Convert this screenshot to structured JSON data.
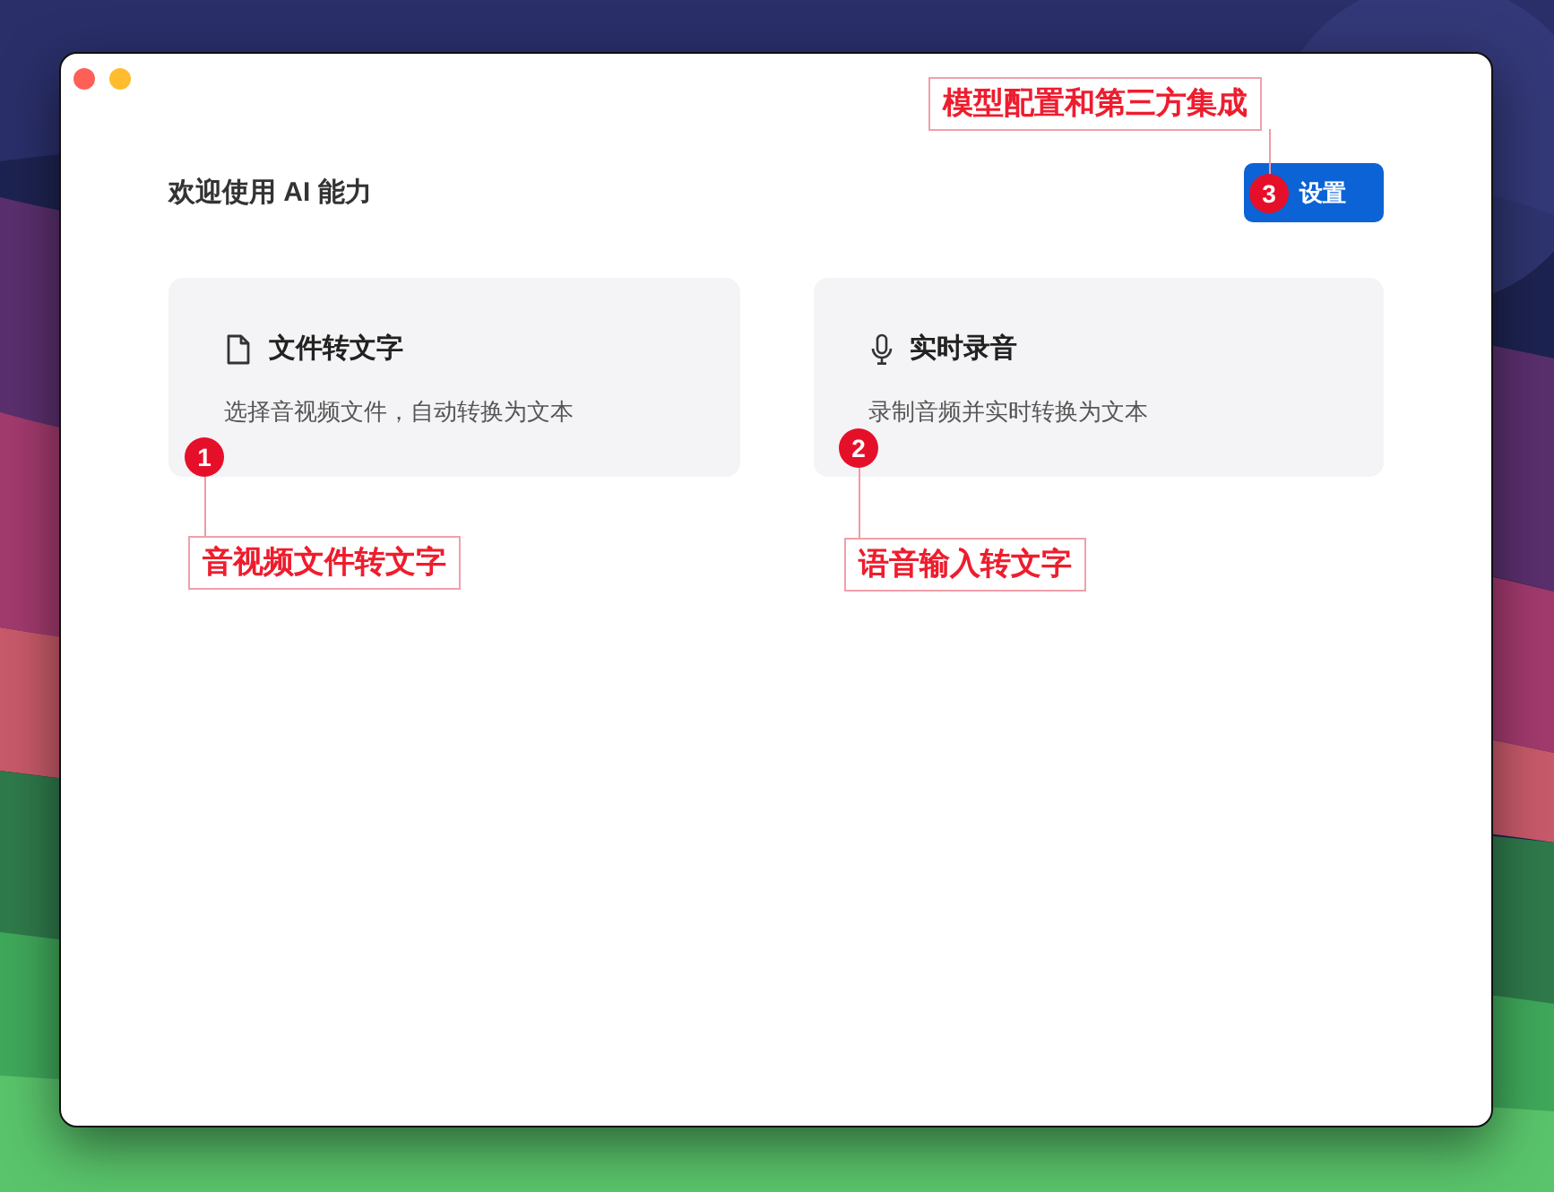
{
  "header": {
    "title": "欢迎使用 AI 能力",
    "settings_button": "设置"
  },
  "cards": [
    {
      "kind": "file",
      "title": "文件转文字",
      "description": "选择音视频文件，自动转换为文本"
    },
    {
      "kind": "microphone",
      "title": "实时录音",
      "description": "录制音频并实时转换为文本"
    }
  ],
  "annotations": [
    {
      "number": "1",
      "label": "音视频文件转文字"
    },
    {
      "number": "2",
      "label": "语音输入转文字"
    },
    {
      "number": "3",
      "label": "模型配置和第三方集成"
    }
  ]
}
